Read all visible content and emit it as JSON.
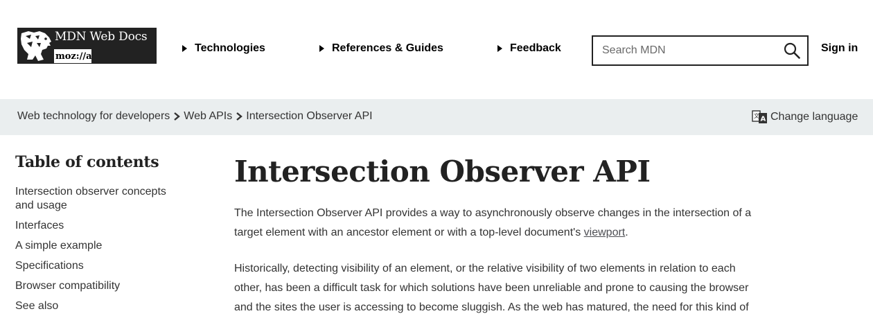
{
  "logo": {
    "title": "MDN Web Docs",
    "subtitle": "moz://a"
  },
  "nav": {
    "items": [
      {
        "label": "Technologies"
      },
      {
        "label": "References & Guides"
      },
      {
        "label": "Feedback"
      }
    ],
    "search_placeholder": "Search MDN",
    "signin_label": "Sign in"
  },
  "breadcrumb": {
    "items": [
      {
        "label": "Web technology for developers"
      },
      {
        "label": "Web APIs"
      },
      {
        "label": "Intersection Observer API"
      }
    ],
    "change_language": "Change language"
  },
  "toc": {
    "title": "Table of contents",
    "items": [
      {
        "label": "Intersection observer concepts and usage"
      },
      {
        "label": "Interfaces"
      },
      {
        "label": "A simple example"
      },
      {
        "label": "Specifications"
      },
      {
        "label": "Browser compatibility"
      },
      {
        "label": "See also"
      }
    ]
  },
  "article": {
    "title": "Intersection Observer API",
    "para1_before": "The Intersection Observer API provides a way to asynchronously observe changes in the intersection of a target element with an ancestor element or with a top-level document's ",
    "para1_link": "viewport",
    "para1_after": ".",
    "para2": "Historically, detecting visibility of an element, or the relative visibility of two elements in relation to each other, has been a difficult task for which solutions have been unreliable and prone to causing the browser and the sites the user is accessing to become sluggish. As the web has matured, the need for this kind of"
  }
}
